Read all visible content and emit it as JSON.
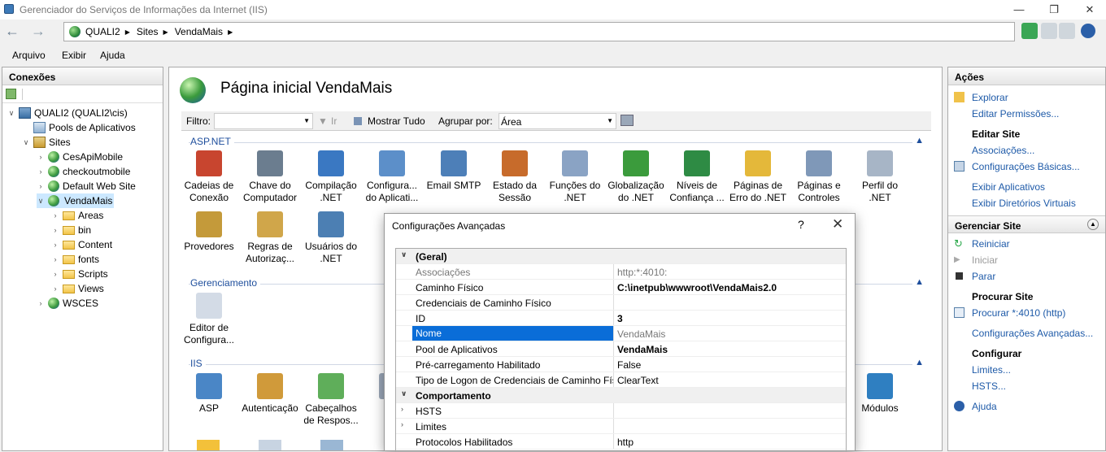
{
  "window": {
    "title": "Gerenciador do Serviços de Informações da Internet (IIS)"
  },
  "address": {
    "segments": [
      "QUALI2",
      "Sites",
      "VendaMais"
    ]
  },
  "menu": [
    "Arquivo",
    "Exibir",
    "Ajuda"
  ],
  "connections": {
    "header": "Conexões",
    "tree": [
      {
        "label": "QUALI2 (QUALI2\\cis)",
        "level": 0,
        "icon": "server-icon",
        "twist": "down"
      },
      {
        "label": "Pools de Aplicativos",
        "level": 1,
        "icon": "app-pool-icon",
        "twist": ""
      },
      {
        "label": "Sites",
        "level": 1,
        "icon": "sites-folder-icon",
        "twist": "down"
      },
      {
        "label": "CesApiMobile",
        "level": 2,
        "icon": "globe-icon",
        "twist": "right"
      },
      {
        "label": "checkoutmobile",
        "level": 2,
        "icon": "globe-icon",
        "twist": "right"
      },
      {
        "label": "Default Web Site",
        "level": 2,
        "icon": "globe-icon",
        "twist": "right"
      },
      {
        "label": "VendaMais",
        "level": 2,
        "icon": "globe-icon",
        "twist": "down",
        "selected": true
      },
      {
        "label": "Areas",
        "level": 3,
        "icon": "folder-icon",
        "twist": "right"
      },
      {
        "label": "bin",
        "level": 3,
        "icon": "folder-icon",
        "twist": "right"
      },
      {
        "label": "Content",
        "level": 3,
        "icon": "folder-icon",
        "twist": "right"
      },
      {
        "label": "fonts",
        "level": 3,
        "icon": "folder-icon",
        "twist": "right"
      },
      {
        "label": "Scripts",
        "level": 3,
        "icon": "folder-icon",
        "twist": "right"
      },
      {
        "label": "Views",
        "level": 3,
        "icon": "folder-icon",
        "twist": "right"
      },
      {
        "label": "WSCES",
        "level": 2,
        "icon": "globe-icon",
        "twist": "right"
      }
    ]
  },
  "main": {
    "title": "Página inicial VendaMais",
    "filter": {
      "label": "Filtro:",
      "go": "Ir",
      "show_all": "Mostrar Tudo",
      "group_label": "Agrupar por:",
      "group_value": "Área"
    },
    "groups": {
      "aspnet": {
        "title": "ASP.NET",
        "features": [
          [
            "Cadeias de",
            "Conexão"
          ],
          [
            "Chave do",
            "Computador"
          ],
          [
            "Compilação",
            ".NET"
          ],
          [
            "Configura...",
            "do Aplicati..."
          ],
          [
            "Email SMTP",
            ""
          ],
          [
            "Estado da",
            "Sessão"
          ],
          [
            "Funções do",
            ".NET"
          ],
          [
            "Globalização",
            "do .NET"
          ],
          [
            "Níveis de",
            "Confiança ..."
          ],
          [
            "Páginas de",
            "Erro do .NET"
          ],
          [
            "Páginas e",
            "Controles"
          ],
          [
            "Perfil do .NET",
            ""
          ],
          [
            "Provedores",
            ""
          ],
          [
            "Regras de",
            "Autorizaç..."
          ],
          [
            "Usuários do",
            ".NET"
          ]
        ]
      },
      "gerenciamento": {
        "title": "Gerenciamento",
        "features": [
          [
            "Editor de",
            "Configura..."
          ]
        ]
      },
      "iis": {
        "title": "IIS",
        "features": [
          [
            "ASP",
            ""
          ],
          [
            "Autenticação",
            ""
          ],
          [
            "Cabeçalhos",
            "de Respos..."
          ],
          [
            "Ca",
            "S"
          ],
          [
            "Módulos",
            ""
          ]
        ]
      }
    }
  },
  "actions": {
    "header": "Ações",
    "items": [
      {
        "type": "link",
        "label": "Explorar",
        "icon": "explore-icon"
      },
      {
        "type": "link",
        "label": "Editar Permissões...",
        "icon": ""
      },
      {
        "type": "head",
        "label": "Editar Site"
      },
      {
        "type": "link",
        "label": "Associações...",
        "icon": ""
      },
      {
        "type": "link",
        "label": "Configurações Básicas...",
        "icon": "basic-settings-icon"
      },
      {
        "type": "link",
        "label": "Exibir Aplicativos",
        "icon": ""
      },
      {
        "type": "link",
        "label": "Exibir Diretórios Virtuais",
        "icon": ""
      }
    ],
    "manage": {
      "header": "Gerenciar Site",
      "restart": "Reiniciar",
      "start": "Iniciar",
      "stop": "Parar",
      "browse_head": "Procurar Site",
      "browse": "Procurar *:4010 (http)",
      "advanced": "Configurações Avançadas...",
      "configure_head": "Configurar",
      "limits": "Limites...",
      "hsts": "HSTS...",
      "help": "Ajuda"
    }
  },
  "dialog": {
    "title": "Configurações Avançadas",
    "help": "?",
    "close": "✕",
    "rows": [
      {
        "k": "(Geral)",
        "v": "",
        "cat": true,
        "exp": "down"
      },
      {
        "k": "Associações",
        "v": "http:*:4010:",
        "kstyle": "gray",
        "vstyle": "gray"
      },
      {
        "k": "Caminho Físico",
        "v": "C:\\inetpub\\wwwroot\\VendaMais2.0",
        "vstyle": "bold"
      },
      {
        "k": "Credenciais de Caminho Físico",
        "v": ""
      },
      {
        "k": "ID",
        "v": "3",
        "vstyle": "bold"
      },
      {
        "k": "Nome",
        "v": "VendaMais",
        "hl": true,
        "vstyle": "gray"
      },
      {
        "k": "Pool de Aplicativos",
        "v": "VendaMais",
        "vstyle": "bold"
      },
      {
        "k": "Pré-carregamento Habilitado",
        "v": "False"
      },
      {
        "k": "Tipo de Logon de Credenciais de Caminho Físico",
        "v": "ClearText"
      },
      {
        "k": "Comportamento",
        "v": "",
        "cat": true,
        "exp": "down"
      },
      {
        "k": "HSTS",
        "v": "",
        "exp": "right"
      },
      {
        "k": "Limites",
        "v": "",
        "exp": "right"
      },
      {
        "k": "Protocolos Habilitados",
        "v": "http"
      }
    ]
  }
}
